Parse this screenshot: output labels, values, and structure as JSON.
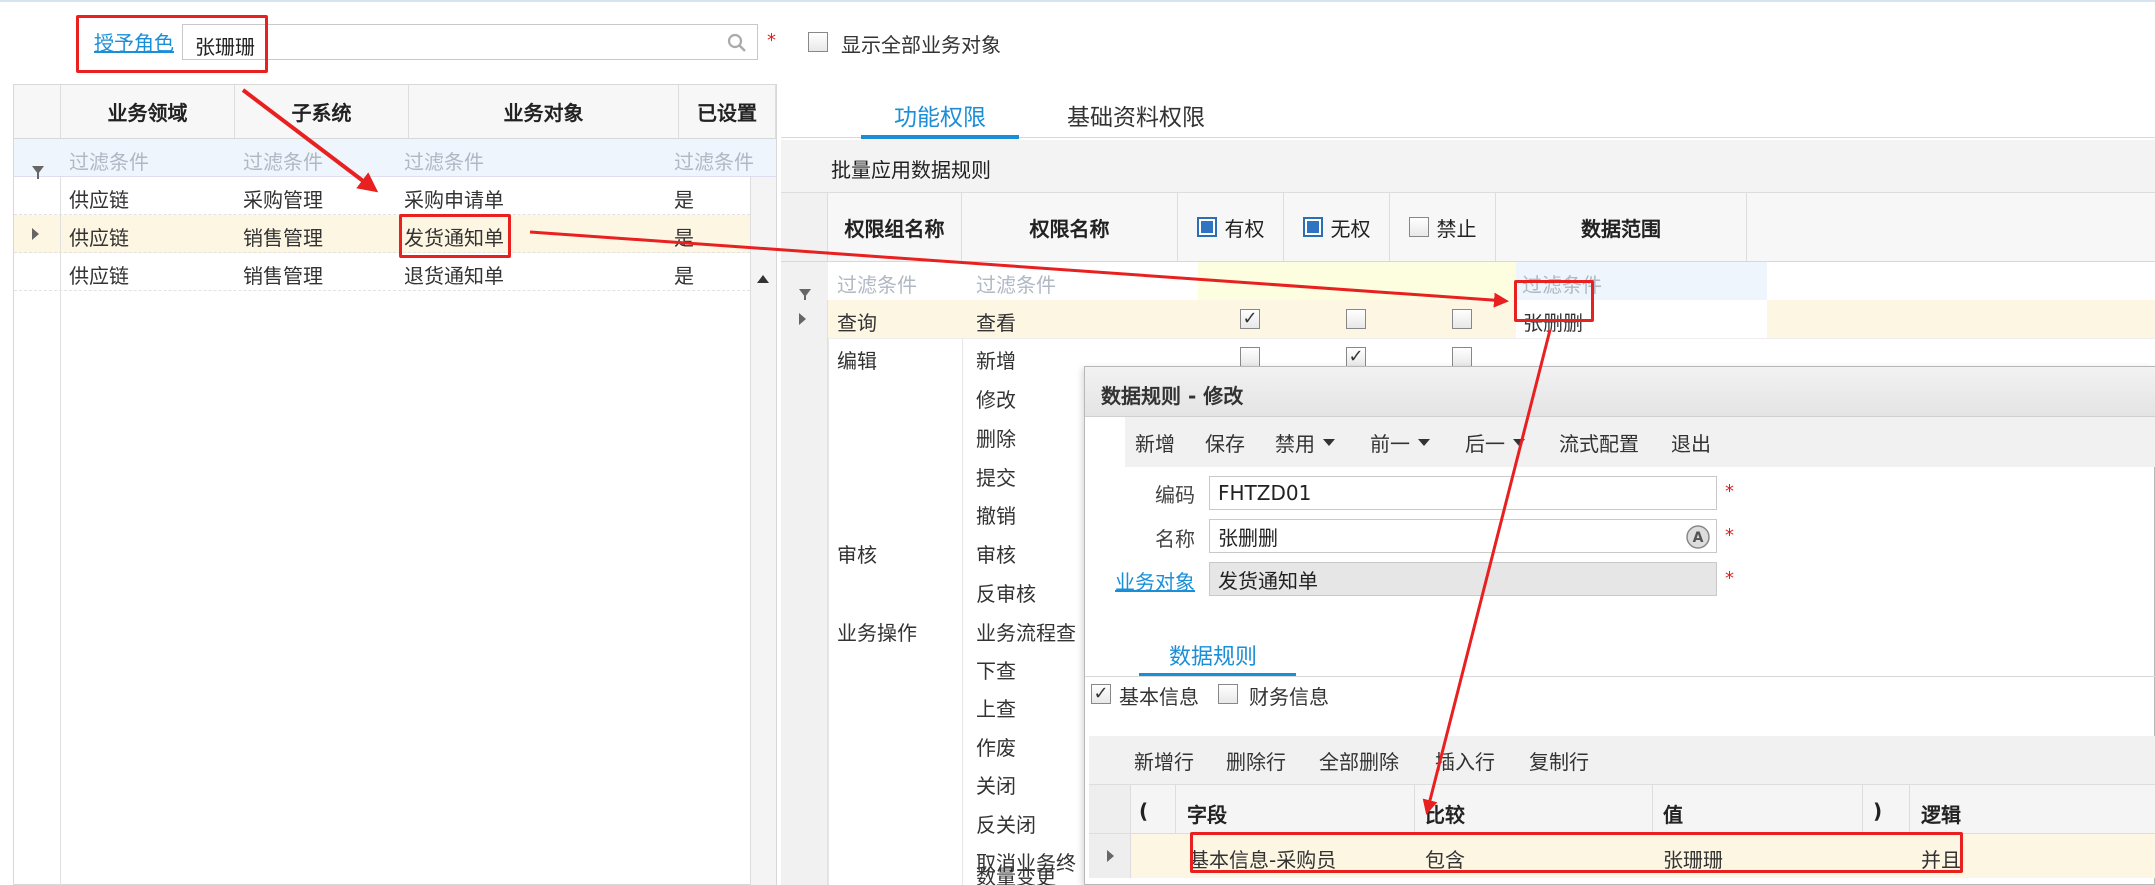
{
  "top": {
    "role_label": "授予角色",
    "role_value": "张珊珊",
    "show_all_label": "显示全部业务对象"
  },
  "left_grid": {
    "columns": [
      "业务领域",
      "子系统",
      "业务对象",
      "已设置"
    ],
    "filter_placeholder": "过滤条件",
    "rows": [
      {
        "domain": "供应链",
        "subsystem": "采购管理",
        "object": "采购申请单",
        "set": "是"
      },
      {
        "domain": "供应链",
        "subsystem": "销售管理",
        "object": "发货通知单",
        "set": "是"
      },
      {
        "domain": "供应链",
        "subsystem": "销售管理",
        "object": "退货通知单",
        "set": "是"
      }
    ]
  },
  "tabs": {
    "func": "功能权限",
    "basic": "基础资料权限"
  },
  "batch_label": "批量应用数据规则",
  "perm_grid": {
    "col_group": "权限组名称",
    "col_name": "权限名称",
    "col_yes": "有权",
    "col_no": "无权",
    "col_forbid": "禁止",
    "col_scope": "数据范围",
    "filter_placeholder": "过滤条件",
    "rows": [
      {
        "group": "查询",
        "name": "查看",
        "yes": true,
        "no": false,
        "forbid": false,
        "scope": "张删删"
      },
      {
        "group": "编辑",
        "name": "新增",
        "yes": false,
        "no": true,
        "forbid": false,
        "scope": ""
      },
      {
        "group": "",
        "name": "修改"
      },
      {
        "group": "",
        "name": "删除"
      },
      {
        "group": "",
        "name": "提交"
      },
      {
        "group": "",
        "name": "撤销"
      },
      {
        "group": "审核",
        "name": "审核"
      },
      {
        "group": "",
        "name": "反审核"
      },
      {
        "group": "业务操作",
        "name": "业务流程查"
      },
      {
        "group": "",
        "name": "下查"
      },
      {
        "group": "",
        "name": "上查"
      },
      {
        "group": "",
        "name": "作废"
      },
      {
        "group": "",
        "name": "关闭"
      },
      {
        "group": "",
        "name": "反关闭"
      },
      {
        "group": "",
        "name": "取消业务终"
      },
      {
        "group": "",
        "name": "数量变更"
      }
    ]
  },
  "dialog": {
    "title": "数据规则 - 修改",
    "toolbar": [
      "新增",
      "保存",
      "禁用",
      "前一",
      "后一",
      "流式配置",
      "退出"
    ],
    "code_label": "编码",
    "code_value": "FHTZD01",
    "name_label": "名称",
    "name_value": "张删删",
    "object_label": "业务对象",
    "object_value": "发货通知单",
    "tab": "数据规则",
    "basic_info": "基本信息",
    "finance_info": "财务信息",
    "row_toolbar": [
      "新增行",
      "删除行",
      "全部删除",
      "插入行",
      "复制行"
    ],
    "cond_columns": {
      "paren_open": "(",
      "field": "字段",
      "compare": "比较",
      "value": "值",
      "paren_close": ")",
      "logic": "逻辑"
    },
    "cond_row": {
      "field": "基本信息-采购员",
      "compare": "包含",
      "value": "张珊珊",
      "logic": "并且"
    }
  },
  "colors": {
    "accent": "#1a8fd8",
    "highlight": "#e82020",
    "row_hl": "#fdf6e3"
  }
}
